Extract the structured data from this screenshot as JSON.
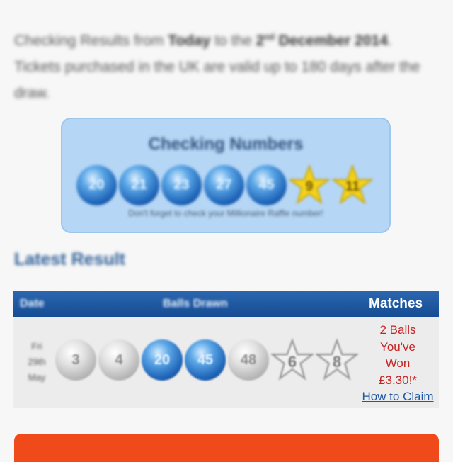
{
  "intro": {
    "part1": "Checking Results from ",
    "bold1": "Today",
    "part2": " to the ",
    "date_num": "2",
    "date_sup": "nd",
    "date_rest": " December 2014",
    "part3": ". Tickets purchased in the UK are valid up to 180 days after the draw."
  },
  "checking": {
    "title": "Checking Numbers",
    "balls": [
      "20",
      "21",
      "23",
      "27",
      "45"
    ],
    "stars": [
      "9",
      "11"
    ],
    "note": "Don't forget to check your Millionaire Raffle number!"
  },
  "latest": {
    "title": "Latest Result",
    "headers": {
      "date": "Date",
      "balls": "Balls Drawn",
      "matches": "Matches"
    },
    "date_lines": [
      "Fri",
      "29th",
      "May"
    ],
    "balls": [
      {
        "n": "3",
        "matched": false
      },
      {
        "n": "4",
        "matched": false
      },
      {
        "n": "20",
        "matched": true
      },
      {
        "n": "45",
        "matched": true
      },
      {
        "n": "48",
        "matched": false
      }
    ],
    "stars": [
      "6",
      "8"
    ],
    "matches": {
      "line1": "2 Balls",
      "line2": "You've",
      "line3": "Won",
      "line4": "£3.30!*",
      "link": "How to Claim"
    }
  },
  "colors": {
    "accent_blue": "#1f64b8",
    "header_blue": "#154b92",
    "win_red": "#c62323",
    "cta_orange": "#f04a1b"
  }
}
